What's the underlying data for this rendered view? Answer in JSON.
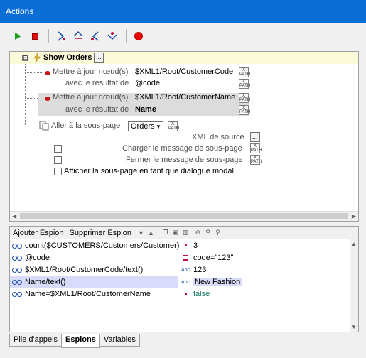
{
  "window": {
    "title": "Actions"
  },
  "toolbar": {
    "buttons": [
      {
        "name": "run",
        "icon": "run-triangle-icon"
      },
      {
        "name": "stop",
        "icon": "stop-square-icon"
      },
      {
        "name": "step-into",
        "icon": "step-into-icon"
      },
      {
        "name": "step-over",
        "icon": "step-over-icon"
      },
      {
        "name": "step-out",
        "icon": "step-out-icon"
      },
      {
        "name": "step-next",
        "icon": "step-next-icon"
      },
      {
        "name": "breakpoint",
        "icon": "breakpoint-circle-icon"
      }
    ],
    "colors": {
      "run": "#1ea01e",
      "stop": "#e01010",
      "breakpoint": "#e00000"
    }
  },
  "tree": {
    "root": {
      "expander": "⊟",
      "label": "Show Orders",
      "more": "..."
    },
    "actions": [
      {
        "label": "Mettre à jour nœud(s)",
        "target": "$XML1/Root/CustomerCode",
        "sub_label": "avec le résultat de",
        "sub_value": "@code"
      },
      {
        "label": "Mettre à jour nœud(s)",
        "target": "$XML1/Root/CustomerName",
        "sub_label": "avec le résultat de",
        "sub_value": "Name"
      }
    ],
    "goto": {
      "label": "Aller à la sous-page",
      "combo_value": "Orders",
      "source_label": "XML de source",
      "source_more": "...",
      "options": [
        {
          "label": "Charger le message de sous-page"
        },
        {
          "label": "Fermer le message de sous-page"
        },
        {
          "label": "Afficher la sous-page en tant que dialogue modal"
        }
      ]
    },
    "xpath_btn": "X PATH"
  },
  "watch": {
    "toolbar": {
      "add": "Ajouter Espion",
      "remove": "Supprimer Espion"
    },
    "rows": [
      {
        "expr": "count($CUSTOMERS/Customers/Customer)",
        "type": "num",
        "type_label": "",
        "value": "3"
      },
      {
        "expr": "@code",
        "type": "attr",
        "type_label": "",
        "value": "code=\"123\""
      },
      {
        "expr": "$XML1/Root/CustomerCode/text()",
        "type": "text",
        "type_label": "Abc",
        "value": "123"
      },
      {
        "expr": "Name/text()",
        "type": "text",
        "type_label": "Abc",
        "value": "New Fashion"
      },
      {
        "expr": "Name=$XML1/Root/CustomerName",
        "type": "bool",
        "type_label": "",
        "value": "false"
      }
    ],
    "selected_row": 3,
    "value_colors": {
      "bool": "#1a7a6a",
      "default": "#000000",
      "selected_bg": "#d8dcfa"
    }
  },
  "tabs": [
    {
      "label": "Pile d'appels"
    },
    {
      "label": "Espions",
      "active": true
    },
    {
      "label": "Variables"
    }
  ]
}
